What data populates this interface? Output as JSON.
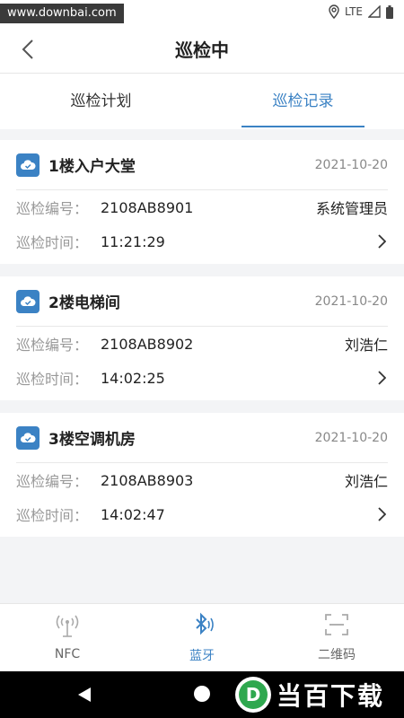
{
  "status_bar": {
    "watermark": "www.downbai.com",
    "network": "LTE"
  },
  "nav": {
    "title": "巡检中"
  },
  "tabs": [
    {
      "label": "巡检计划",
      "active": false
    },
    {
      "label": "巡检记录",
      "active": true
    }
  ],
  "records": [
    {
      "name": "1楼入户大堂",
      "date": "2021-10-20",
      "code_label": "巡检编号：",
      "code": "2108AB8901",
      "inspector": "系统管理员",
      "time_label": "巡检时间：",
      "time": "11:21:29"
    },
    {
      "name": "2楼电梯间",
      "date": "2021-10-20",
      "code_label": "巡检编号：",
      "code": "2108AB8902",
      "inspector": "刘浩仁",
      "time_label": "巡检时间：",
      "time": "14:02:25"
    },
    {
      "name": "3楼空调机房",
      "date": "2021-10-20",
      "code_label": "巡检编号：",
      "code": "2108AB8903",
      "inspector": "刘浩仁",
      "time_label": "巡检时间：",
      "time": "14:02:47"
    }
  ],
  "bottom_tabs": [
    {
      "label": "NFC",
      "icon": "nfc-antenna-icon",
      "active": false
    },
    {
      "label": "蓝牙",
      "icon": "bluetooth-icon",
      "active": true
    },
    {
      "label": "二维码",
      "icon": "qr-scan-icon",
      "active": false
    }
  ],
  "brand": {
    "letter": "D",
    "text": "当百下载"
  },
  "colors": {
    "accent": "#3b82c4",
    "background": "#f3f4f6"
  }
}
